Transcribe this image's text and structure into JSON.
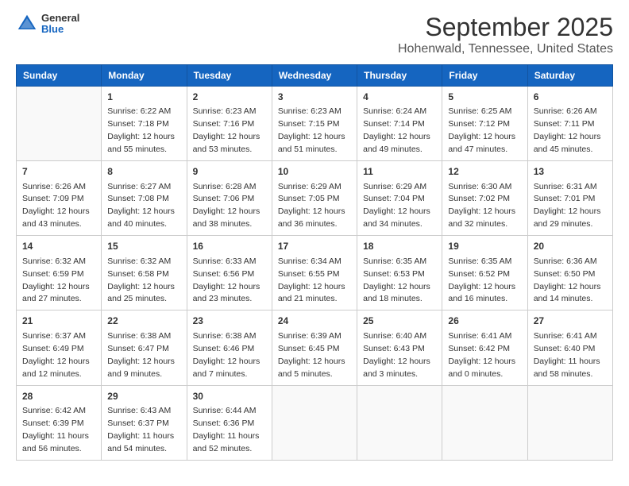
{
  "logo": {
    "general": "General",
    "blue": "Blue"
  },
  "title": "September 2025",
  "subtitle": "Hohenwald, Tennessee, United States",
  "weekdays": [
    "Sunday",
    "Monday",
    "Tuesday",
    "Wednesday",
    "Thursday",
    "Friday",
    "Saturday"
  ],
  "weeks": [
    [
      {
        "day": "",
        "info": ""
      },
      {
        "day": "1",
        "info": "Sunrise: 6:22 AM\nSunset: 7:18 PM\nDaylight: 12 hours\nand 55 minutes."
      },
      {
        "day": "2",
        "info": "Sunrise: 6:23 AM\nSunset: 7:16 PM\nDaylight: 12 hours\nand 53 minutes."
      },
      {
        "day": "3",
        "info": "Sunrise: 6:23 AM\nSunset: 7:15 PM\nDaylight: 12 hours\nand 51 minutes."
      },
      {
        "day": "4",
        "info": "Sunrise: 6:24 AM\nSunset: 7:14 PM\nDaylight: 12 hours\nand 49 minutes."
      },
      {
        "day": "5",
        "info": "Sunrise: 6:25 AM\nSunset: 7:12 PM\nDaylight: 12 hours\nand 47 minutes."
      },
      {
        "day": "6",
        "info": "Sunrise: 6:26 AM\nSunset: 7:11 PM\nDaylight: 12 hours\nand 45 minutes."
      }
    ],
    [
      {
        "day": "7",
        "info": "Sunrise: 6:26 AM\nSunset: 7:09 PM\nDaylight: 12 hours\nand 43 minutes."
      },
      {
        "day": "8",
        "info": "Sunrise: 6:27 AM\nSunset: 7:08 PM\nDaylight: 12 hours\nand 40 minutes."
      },
      {
        "day": "9",
        "info": "Sunrise: 6:28 AM\nSunset: 7:06 PM\nDaylight: 12 hours\nand 38 minutes."
      },
      {
        "day": "10",
        "info": "Sunrise: 6:29 AM\nSunset: 7:05 PM\nDaylight: 12 hours\nand 36 minutes."
      },
      {
        "day": "11",
        "info": "Sunrise: 6:29 AM\nSunset: 7:04 PM\nDaylight: 12 hours\nand 34 minutes."
      },
      {
        "day": "12",
        "info": "Sunrise: 6:30 AM\nSunset: 7:02 PM\nDaylight: 12 hours\nand 32 minutes."
      },
      {
        "day": "13",
        "info": "Sunrise: 6:31 AM\nSunset: 7:01 PM\nDaylight: 12 hours\nand 29 minutes."
      }
    ],
    [
      {
        "day": "14",
        "info": "Sunrise: 6:32 AM\nSunset: 6:59 PM\nDaylight: 12 hours\nand 27 minutes."
      },
      {
        "day": "15",
        "info": "Sunrise: 6:32 AM\nSunset: 6:58 PM\nDaylight: 12 hours\nand 25 minutes."
      },
      {
        "day": "16",
        "info": "Sunrise: 6:33 AM\nSunset: 6:56 PM\nDaylight: 12 hours\nand 23 minutes."
      },
      {
        "day": "17",
        "info": "Sunrise: 6:34 AM\nSunset: 6:55 PM\nDaylight: 12 hours\nand 21 minutes."
      },
      {
        "day": "18",
        "info": "Sunrise: 6:35 AM\nSunset: 6:53 PM\nDaylight: 12 hours\nand 18 minutes."
      },
      {
        "day": "19",
        "info": "Sunrise: 6:35 AM\nSunset: 6:52 PM\nDaylight: 12 hours\nand 16 minutes."
      },
      {
        "day": "20",
        "info": "Sunrise: 6:36 AM\nSunset: 6:50 PM\nDaylight: 12 hours\nand 14 minutes."
      }
    ],
    [
      {
        "day": "21",
        "info": "Sunrise: 6:37 AM\nSunset: 6:49 PM\nDaylight: 12 hours\nand 12 minutes."
      },
      {
        "day": "22",
        "info": "Sunrise: 6:38 AM\nSunset: 6:47 PM\nDaylight: 12 hours\nand 9 minutes."
      },
      {
        "day": "23",
        "info": "Sunrise: 6:38 AM\nSunset: 6:46 PM\nDaylight: 12 hours\nand 7 minutes."
      },
      {
        "day": "24",
        "info": "Sunrise: 6:39 AM\nSunset: 6:45 PM\nDaylight: 12 hours\nand 5 minutes."
      },
      {
        "day": "25",
        "info": "Sunrise: 6:40 AM\nSunset: 6:43 PM\nDaylight: 12 hours\nand 3 minutes."
      },
      {
        "day": "26",
        "info": "Sunrise: 6:41 AM\nSunset: 6:42 PM\nDaylight: 12 hours\nand 0 minutes."
      },
      {
        "day": "27",
        "info": "Sunrise: 6:41 AM\nSunset: 6:40 PM\nDaylight: 11 hours\nand 58 minutes."
      }
    ],
    [
      {
        "day": "28",
        "info": "Sunrise: 6:42 AM\nSunset: 6:39 PM\nDaylight: 11 hours\nand 56 minutes."
      },
      {
        "day": "29",
        "info": "Sunrise: 6:43 AM\nSunset: 6:37 PM\nDaylight: 11 hours\nand 54 minutes."
      },
      {
        "day": "30",
        "info": "Sunrise: 6:44 AM\nSunset: 6:36 PM\nDaylight: 11 hours\nand 52 minutes."
      },
      {
        "day": "",
        "info": ""
      },
      {
        "day": "",
        "info": ""
      },
      {
        "day": "",
        "info": ""
      },
      {
        "day": "",
        "info": ""
      }
    ]
  ]
}
